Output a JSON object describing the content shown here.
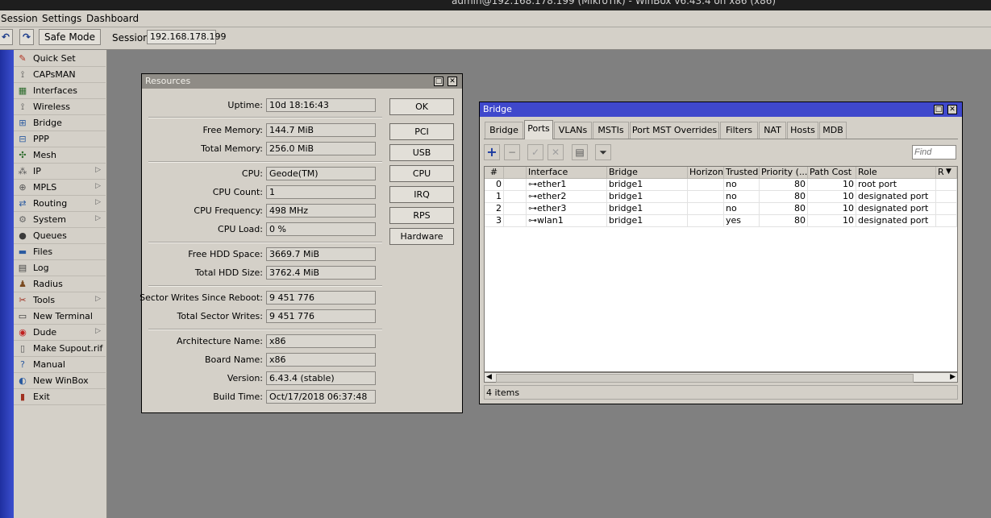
{
  "os_title": "admin@192.168.178.199 (MikroTik) - WinBox v6.43.4 on x86 (x86)",
  "menu": [
    "Session",
    "Settings",
    "Dashboard"
  ],
  "toolbar": {
    "undo_icon": "undo-icon",
    "redo_icon": "redo-icon",
    "safe_mode": "Safe Mode",
    "session_label": "Session:",
    "session_value": "192.168.178.199"
  },
  "sidebar": [
    {
      "label": "Quick Set",
      "icon": "quick-set-icon",
      "glyph": "✎",
      "color": "#b03020",
      "submenu": false
    },
    {
      "label": "CAPsMAN",
      "icon": "antenna-icon",
      "glyph": "⟟",
      "color": "#444",
      "submenu": false
    },
    {
      "label": "Interfaces",
      "icon": "interfaces-icon",
      "glyph": "▦",
      "color": "#2a6a2a",
      "submenu": false
    },
    {
      "label": "Wireless",
      "icon": "wireless-icon",
      "glyph": "⟟",
      "color": "#444",
      "submenu": false
    },
    {
      "label": "Bridge",
      "icon": "bridge-icon",
      "glyph": "⊞",
      "color": "#2a5aa0",
      "submenu": false
    },
    {
      "label": "PPP",
      "icon": "ppp-icon",
      "glyph": "⊟",
      "color": "#2a5aa0",
      "submenu": false
    },
    {
      "label": "Mesh",
      "icon": "mesh-icon",
      "glyph": "✣",
      "color": "#2a6a2a",
      "submenu": false
    },
    {
      "label": "IP",
      "icon": "ip-icon",
      "glyph": "⁂",
      "color": "#555",
      "submenu": true
    },
    {
      "label": "MPLS",
      "icon": "mpls-icon",
      "glyph": "⊕",
      "color": "#555",
      "submenu": true
    },
    {
      "label": "Routing",
      "icon": "routing-icon",
      "glyph": "⇄",
      "color": "#2a5aa0",
      "submenu": true
    },
    {
      "label": "System",
      "icon": "system-icon",
      "glyph": "⚙",
      "color": "#666",
      "submenu": true
    },
    {
      "label": "Queues",
      "icon": "queues-icon",
      "glyph": "●",
      "color": "#3a3a3a",
      "submenu": false
    },
    {
      "label": "Files",
      "icon": "files-icon",
      "glyph": "▬",
      "color": "#2a5aa0",
      "submenu": false
    },
    {
      "label": "Log",
      "icon": "log-icon",
      "glyph": "▤",
      "color": "#444",
      "submenu": false
    },
    {
      "label": "Radius",
      "icon": "radius-icon",
      "glyph": "♟",
      "color": "#7a4a20",
      "submenu": false
    },
    {
      "label": "Tools",
      "icon": "tools-icon",
      "glyph": "✂",
      "color": "#a03020",
      "submenu": true
    },
    {
      "label": "New Terminal",
      "icon": "terminal-icon",
      "glyph": "▭",
      "color": "#333",
      "submenu": false
    },
    {
      "label": "Dude",
      "icon": "dude-icon",
      "glyph": "◉",
      "color": "#c02020",
      "submenu": true
    },
    {
      "label": "Make Supout.rif",
      "icon": "supout-icon",
      "glyph": "▯",
      "color": "#555",
      "submenu": false
    },
    {
      "label": "Manual",
      "icon": "manual-icon",
      "glyph": "?",
      "color": "#2a5aa0",
      "submenu": false
    },
    {
      "label": "New WinBox",
      "icon": "winbox-icon",
      "glyph": "◐",
      "color": "#2a5aa0",
      "submenu": false
    },
    {
      "label": "Exit",
      "icon": "exit-icon",
      "glyph": "▮",
      "color": "#a03020",
      "submenu": false
    }
  ],
  "resources": {
    "title": "Resources",
    "rows": [
      {
        "label": "Uptime:",
        "value": "10d 18:16:43"
      },
      {
        "label": "Free Memory:",
        "value": "144.7 MiB"
      },
      {
        "label": "Total Memory:",
        "value": "256.0 MiB"
      },
      {
        "label": "CPU:",
        "value": "Geode(TM)"
      },
      {
        "label": "CPU Count:",
        "value": "1"
      },
      {
        "label": "CPU Frequency:",
        "value": "498 MHz"
      },
      {
        "label": "CPU Load:",
        "value": "0 %"
      },
      {
        "label": "Free HDD Space:",
        "value": "3669.7 MiB"
      },
      {
        "label": "Total HDD Size:",
        "value": "3762.4 MiB"
      },
      {
        "label": "Sector Writes Since Reboot:",
        "value": "9 451 776"
      },
      {
        "label": "Total Sector Writes:",
        "value": "9 451 776"
      },
      {
        "label": "Architecture Name:",
        "value": "x86"
      },
      {
        "label": "Board Name:",
        "value": "x86"
      },
      {
        "label": "Version:",
        "value": "6.43.4 (stable)"
      },
      {
        "label": "Build Time:",
        "value": "Oct/17/2018 06:37:48"
      }
    ],
    "buttons": [
      "OK",
      "PCI",
      "USB",
      "CPU",
      "IRQ",
      "RPS",
      "Hardware"
    ]
  },
  "bridge": {
    "title": "Bridge",
    "tabs": [
      "Bridge",
      "Ports",
      "VLANs",
      "MSTIs",
      "Port MST Overrides",
      "Filters",
      "NAT",
      "Hosts",
      "MDB"
    ],
    "active_tab": "Ports",
    "tools": [
      {
        "name": "add-icon",
        "glyph": "+",
        "color": "#1a3aa0"
      },
      {
        "name": "remove-icon",
        "glyph": "−",
        "color": "#7a7a7a"
      },
      {
        "name": "enable-icon",
        "glyph": "✓",
        "color": "#a0a0a0"
      },
      {
        "name": "disable-icon",
        "glyph": "✕",
        "color": "#a0a0a0"
      },
      {
        "name": "comment-icon",
        "glyph": "▤",
        "color": "#555"
      },
      {
        "name": "filter-icon",
        "glyph": "⏷",
        "color": "#333"
      }
    ],
    "find_placeholder": "Find",
    "columns": [
      "#",
      "",
      "Interface",
      "Bridge",
      "Horizon",
      "Trusted",
      "Priority (...",
      "Path Cost",
      "Role",
      "R"
    ],
    "rows": [
      {
        "num": "0",
        "interface": "ether1",
        "bridge": "bridge1",
        "horizon": "",
        "trusted": "no",
        "priority": "80",
        "path_cost": "10",
        "role": "root port"
      },
      {
        "num": "1",
        "interface": "ether2",
        "bridge": "bridge1",
        "horizon": "",
        "trusted": "no",
        "priority": "80",
        "path_cost": "10",
        "role": "designated port"
      },
      {
        "num": "2",
        "interface": "ether3",
        "bridge": "bridge1",
        "horizon": "",
        "trusted": "no",
        "priority": "80",
        "path_cost": "10",
        "role": "designated port"
      },
      {
        "num": "3",
        "interface": "wlan1",
        "bridge": "bridge1",
        "horizon": "",
        "trusted": "yes",
        "priority": "80",
        "path_cost": "10",
        "role": "designated port"
      }
    ],
    "status": "4 items"
  }
}
